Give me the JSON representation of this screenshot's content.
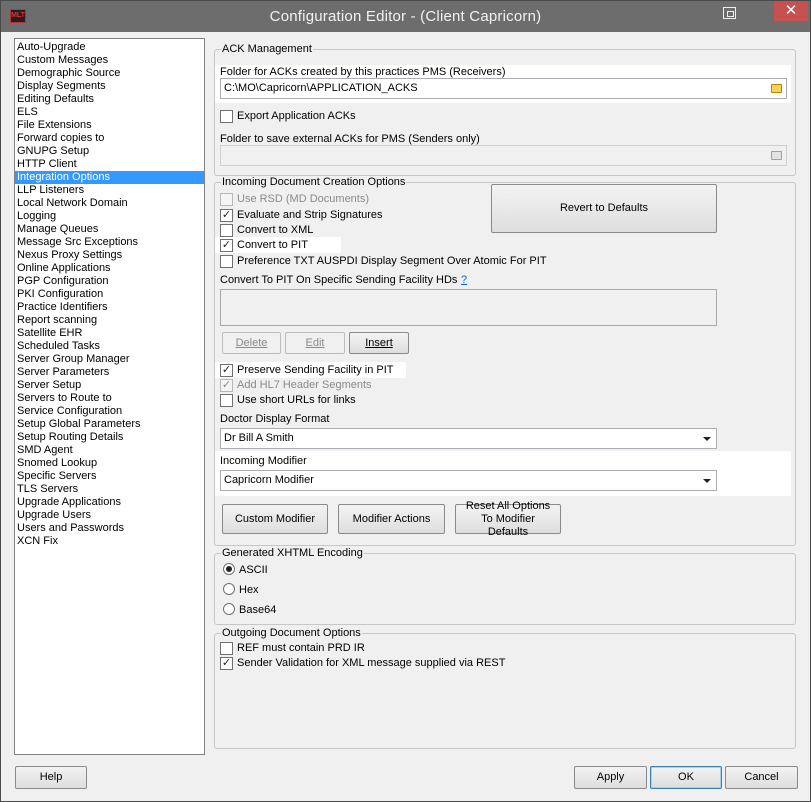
{
  "window": {
    "title": "Configuration Editor -  (Client Capricorn)",
    "app_icon_text": "MLT",
    "close_glyph": "✕"
  },
  "sidebar": {
    "items": [
      "Auto-Upgrade",
      "Custom Messages",
      "Demographic Source",
      "Display Segments",
      "Editing Defaults",
      "ELS",
      "File Extensions",
      "Forward copies to",
      "GNUPG Setup",
      "HTTP Client",
      "Integration Options",
      "LLP Listeners",
      "Local Network Domain",
      "Logging",
      "Manage Queues",
      "Message Src Exceptions",
      "Nexus Proxy Settings",
      "Online Applications",
      "PGP Configuration",
      "PKI Configuration",
      "Practice Identifiers",
      "Report scanning",
      "Satellite EHR",
      "Scheduled Tasks",
      "Server Group Manager",
      "Server Parameters",
      "Server Setup",
      "Servers to Route to",
      "Service Configuration",
      "Setup Global Parameters",
      "Setup Routing Details",
      "SMD Agent",
      "Snomed Lookup",
      "Specific Servers",
      "TLS Servers",
      "Upgrade Applications",
      "Upgrade Users",
      "Users and Passwords",
      "XCN Fix"
    ],
    "selected": "Integration Options"
  },
  "ack": {
    "group_title": "ACK Management",
    "folder_receivers_label": "Folder for ACKs created by this practices PMS (Receivers)",
    "folder_receivers_value": "C:\\MO\\Capricorn\\APPLICATION_ACKS",
    "export_label": "Export Application ACKs",
    "export_checked": false,
    "folder_senders_label": "Folder to save external ACKs for PMS (Senders only)",
    "folder_senders_value": ""
  },
  "incoming": {
    "group_title": "Incoming Document Creation Options",
    "use_rsd_label": "Use RSD (MD Documents)",
    "use_rsd_checked": false,
    "evaluate_label": "Evaluate and Strip Signatures",
    "evaluate_checked": true,
    "convert_xml_label": "Convert to XML",
    "convert_xml_checked": false,
    "convert_pit_label": "Convert to PIT",
    "convert_pit_checked": true,
    "preference_label": "Preference TXT AUSPDI Display Segment Over Atomic For PIT",
    "preference_checked": false,
    "revert_button": "Revert to Defaults",
    "specific_facility_label": "Convert To PIT On Specific Sending Facility HDs",
    "help_link": "?",
    "delete_button": "Delete",
    "edit_button": "Edit",
    "insert_button": "Insert",
    "preserve_label": "Preserve Sending Facility in PIT",
    "preserve_checked": true,
    "add_hl7_label": "Add HL7 Header Segments",
    "add_hl7_checked": true,
    "short_urls_label": "Use short URLs for links",
    "short_urls_checked": false,
    "doctor_format_label": "Doctor Display Format",
    "doctor_format_value": "Dr Bill A Smith",
    "modifier_label": "Incoming Modifier",
    "modifier_value": "Capricorn Modifier",
    "custom_modifier_button": "Custom Modifier",
    "modifier_actions_button": "Modifier Actions",
    "reset_options_button": "Reset All Options To Modifier Defaults"
  },
  "xhtml": {
    "group_title": "Generated XHTML Encoding",
    "options": [
      "ASCII",
      "Hex",
      "Base64"
    ],
    "selected": "ASCII"
  },
  "outgoing": {
    "group_title": "Outgoing Document Options",
    "ref_label": "REF must contain PRD IR",
    "ref_checked": false,
    "sender_label": "Sender Validation for XML message supplied via REST",
    "sender_checked": true
  },
  "footer": {
    "help": "Help",
    "apply": "Apply",
    "ok": "OK",
    "cancel": "Cancel"
  }
}
